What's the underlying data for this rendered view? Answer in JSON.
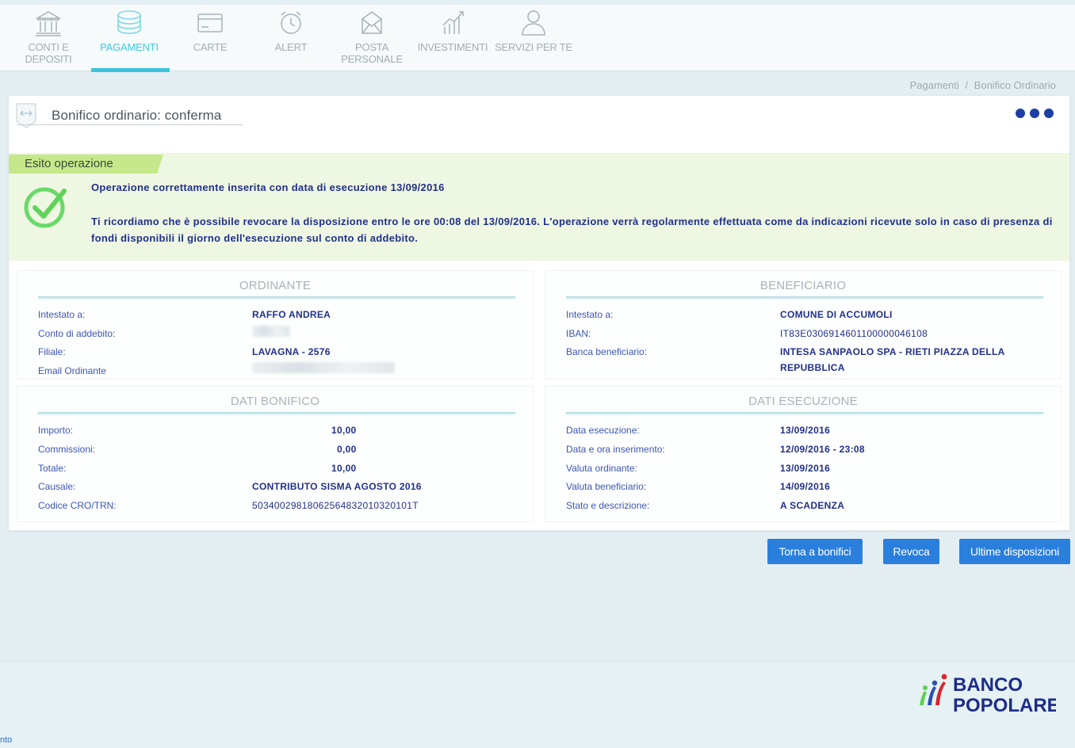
{
  "nav": {
    "items": [
      {
        "label": "CONTI E DEPOSITI",
        "icon": "bank-icon"
      },
      {
        "label": "PAGAMENTI",
        "icon": "coins-icon",
        "active": true
      },
      {
        "label": "CARTE",
        "icon": "card-icon"
      },
      {
        "label": "ALERT",
        "icon": "alarm-clock-icon"
      },
      {
        "label": "POSTA PERSONALE",
        "icon": "mail-icon"
      },
      {
        "label": "INVESTIMENTI",
        "icon": "chart-icon"
      },
      {
        "label": "SERVIZI PER TE",
        "icon": "person-icon"
      }
    ]
  },
  "breadcrumb": {
    "parent": "Pagamenti",
    "separator": "/",
    "current": "Bonifico Ordinario"
  },
  "page": {
    "title": "Bonifico ordinario: conferma",
    "title_icon": "transfer-arrows-icon"
  },
  "esito": {
    "tab_label": "Esito operazione",
    "icon": "check-circle-icon",
    "message": "Operazione correttamente inserita con data di esecuzione 13/09/2016",
    "note": "Ti ricordiamo che è possibile revocare la disposizione entro le ore 00:08 del 13/09/2016. L'operazione verrà regolarmente effettuata come da indicazioni ricevute solo in caso di presenza di fondi disponibili il giorno dell'esecuzione sul conto di addebito."
  },
  "ordinante": {
    "title": "ORDINANTE",
    "intestato_label": "Intestato a:",
    "intestato_value": "RAFFO ANDREA",
    "conto_label": "Conto di addebito:",
    "filiale_label": "Filiale:",
    "filiale_value": "LAVAGNA - 2576",
    "email_label": "Email Ordinante"
  },
  "beneficiario": {
    "title": "BENEFICIARIO",
    "intestato_label": "Intestato a:",
    "intestato_value": "COMUNE DI ACCUMOLI",
    "iban_label": "IBAN:",
    "iban_value": "IT83E0306914601100000046108",
    "banca_label": "Banca beneficiario:",
    "banca_value": "INTESA SANPAOLO SPA - RIETI PIAZZA DELLA REPUBBLICA"
  },
  "dati_bonifico": {
    "title": "DATI BONIFICO",
    "importo_label": "Importo:",
    "importo_value": "10,00",
    "commissioni_label": "Commissioni:",
    "commissioni_value": "0,00",
    "totale_label": "Totale:",
    "totale_value": "10,00",
    "causale_label": "Causale:",
    "causale_value": "CONTRIBUTO SISMA AGOSTO 2016",
    "cro_label": "Codice CRO/TRN:",
    "cro_value": "50340029818062564832010320101T"
  },
  "dati_esecuzione": {
    "title": "DATI ESECUZIONE",
    "data_esecuzione_label": "Data esecuzione:",
    "data_esecuzione_value": "13/09/2016",
    "data_inserimento_label": "Data e ora inserimento:",
    "data_inserimento_value": "12/09/2016 - 23:08",
    "valuta_ordinante_label": "Valuta ordinante:",
    "valuta_ordinante_value": "13/09/2016",
    "valuta_beneficiario_label": "Valuta beneficiario:",
    "valuta_beneficiario_value": "14/09/2016",
    "stato_label": "Stato e descrizione:",
    "stato_value": "A SCADENZA"
  },
  "buttons": {
    "torna": "Torna a bonifici",
    "revoca": "Revoca",
    "ultime": "Ultime disposizioni"
  },
  "footer": {
    "logo_line1": "BANCO",
    "logo_line2": "POPOLARE",
    "link": "nto"
  },
  "colors": {
    "accent": "#39c4dc",
    "button": "#2a7fdd",
    "success": "#5fd35a",
    "text": "#22308a"
  }
}
